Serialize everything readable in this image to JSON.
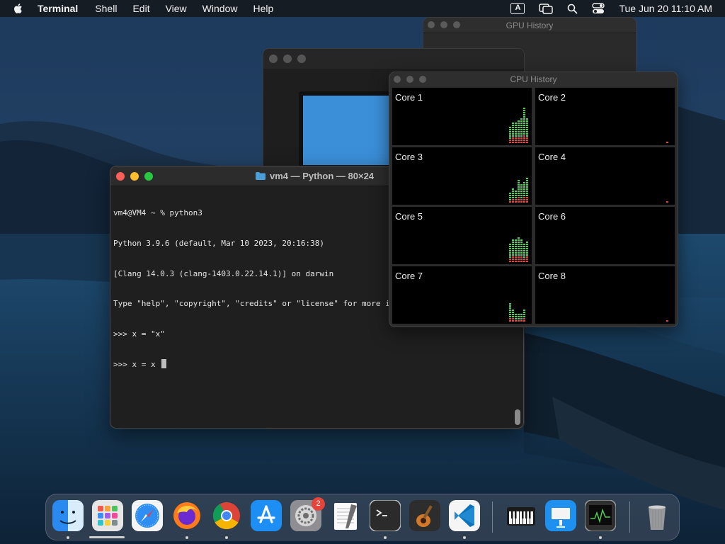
{
  "menubar": {
    "app_name": "Terminal",
    "menus": [
      "Shell",
      "Edit",
      "View",
      "Window",
      "Help"
    ],
    "input_source": "A",
    "clock": "Tue Jun 20  11:10 AM",
    "status_icons": [
      "input-source-icon",
      "screen-mirroring-icon",
      "spotlight-search-icon",
      "control-center-icon"
    ]
  },
  "gpu_window": {
    "title": "GPU History"
  },
  "terminal": {
    "title": "vm4 — Python — 80×24",
    "lines": [
      "vm4@VM4 ~ % python3",
      "Python 3.9.6 (default, Mar 10 2023, 20:16:38)",
      "[Clang 14.0.3 (clang-1403.0.22.14.1)] on darwin",
      "Type \"help\", \"copyright\", \"credits\" or \"license\" for more information.",
      ">>> x = \"x\"",
      ">>> x = x "
    ]
  },
  "cpu_window": {
    "title": "CPU History",
    "cores": [
      {
        "label": "Core 1",
        "load": [
          0.0,
          0.0,
          0.0,
          0.0,
          0.0,
          0.0,
          0.42,
          0.5,
          0.5,
          0.55,
          0.6,
          0.85,
          0.6
        ]
      },
      {
        "label": "Core 2",
        "load": [
          0.0,
          0.0,
          0.0,
          0.0,
          0.0,
          0.0,
          0.0,
          0.0,
          0.0,
          0.0,
          0.0,
          0.04,
          0.0
        ]
      },
      {
        "label": "Core 3",
        "load": [
          0.0,
          0.0,
          0.0,
          0.0,
          0.0,
          0.0,
          0.25,
          0.35,
          0.3,
          0.55,
          0.45,
          0.5,
          0.6
        ]
      },
      {
        "label": "Core 4",
        "load": [
          0.0,
          0.0,
          0.0,
          0.0,
          0.0,
          0.0,
          0.0,
          0.0,
          0.0,
          0.0,
          0.0,
          0.03,
          0.0
        ]
      },
      {
        "label": "Core 5",
        "load": [
          0.0,
          0.0,
          0.0,
          0.0,
          0.0,
          0.0,
          0.45,
          0.55,
          0.55,
          0.6,
          0.55,
          0.45,
          0.5
        ]
      },
      {
        "label": "Core 6",
        "load": [
          0.0,
          0.0,
          0.0,
          0.0,
          0.0,
          0.0,
          0.0,
          0.0,
          0.0,
          0.0,
          0.0,
          0.0,
          0.0
        ]
      },
      {
        "label": "Core 7",
        "load": [
          0.0,
          0.0,
          0.0,
          0.0,
          0.0,
          0.0,
          0.45,
          0.3,
          0.2,
          0.2,
          0.2,
          0.3,
          0.0
        ]
      },
      {
        "label": "Core 8",
        "load": [
          0.0,
          0.0,
          0.0,
          0.0,
          0.0,
          0.0,
          0.0,
          0.0,
          0.0,
          0.0,
          0.0,
          0.03,
          0.0
        ]
      }
    ],
    "colors": {
      "user": "#4fcf55",
      "system": "#e0483f",
      "background": "#000000"
    }
  },
  "dock": {
    "items": [
      {
        "name": "Finder",
        "icon": "finder-icon",
        "running": true
      },
      {
        "name": "Launchpad",
        "icon": "launchpad-icon",
        "running": false
      },
      {
        "name": "Safari",
        "icon": "safari-icon",
        "running": false
      },
      {
        "name": "Firefox",
        "icon": "firefox-icon",
        "running": true
      },
      {
        "name": "Google Chrome",
        "icon": "chrome-icon",
        "running": true
      },
      {
        "name": "App Store",
        "icon": "app-store-icon",
        "running": false
      },
      {
        "name": "System Preferences",
        "icon": "system-preferences-icon",
        "running": false,
        "badge": "2"
      },
      {
        "name": "TextEdit",
        "icon": "textedit-icon",
        "running": false
      },
      {
        "name": "Terminal",
        "icon": "terminal-icon",
        "running": true
      },
      {
        "name": "GarageBand",
        "icon": "garageband-icon",
        "running": false
      },
      {
        "name": "Visual Studio Code",
        "icon": "vscode-icon",
        "running": true
      },
      {
        "name": "MIDI Keyboard",
        "icon": "piano-keyboard-icon",
        "running": false
      },
      {
        "name": "Keynote",
        "icon": "keynote-icon",
        "running": false
      },
      {
        "name": "Activity Monitor",
        "icon": "activity-monitor-icon",
        "running": true
      },
      {
        "name": "Trash",
        "icon": "trash-icon",
        "running": false
      }
    ]
  }
}
